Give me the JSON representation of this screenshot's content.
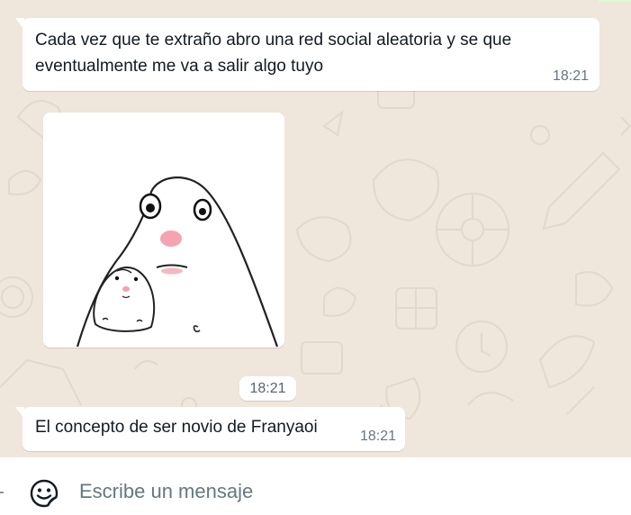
{
  "messages": [
    {
      "text": "Cada vez que te extraño abro una red social aleatoria y se que eventualmente me va a salir algo tuyo",
      "time": "18:21"
    },
    {
      "type": "image",
      "time": "18:21"
    },
    {
      "text": "El concepto de ser novio de Franyaoi",
      "time": "18:21"
    }
  ],
  "composer": {
    "placeholder": "Escribe un mensaje",
    "icon": "sticker-icon"
  },
  "colors": {
    "chat_background": "#efe6dc",
    "bubble": "#ffffff",
    "text": "#111b21",
    "meta": "#667781"
  }
}
